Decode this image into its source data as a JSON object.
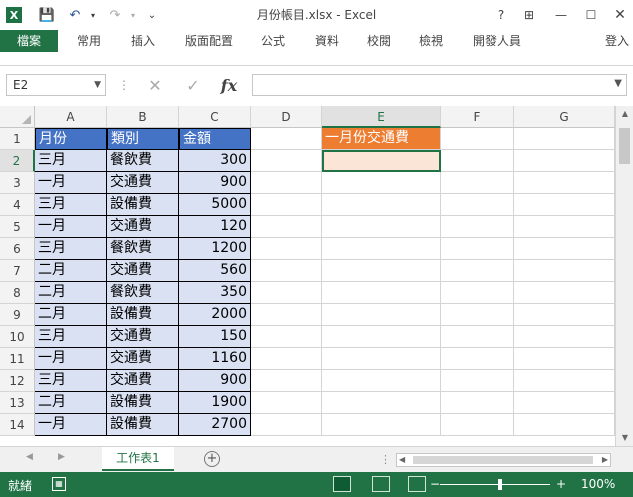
{
  "app": {
    "title": "月份帳目.xlsx - Excel",
    "logo": "X",
    "qat": {
      "save_icon": "💾",
      "undo_icon": "↶",
      "redo_icon": "↷",
      "customize_icon": "⌄"
    },
    "window_buttons": {
      "help": "?",
      "restore_ribbon": "⊞",
      "minimize": "—",
      "maximize": "☐"
    }
  },
  "ribbon": {
    "tabs": [
      "檔案",
      "常用",
      "插入",
      "版面配置",
      "公式",
      "資料",
      "校閱",
      "檢視",
      "開發人員"
    ],
    "signin": "登入"
  },
  "formula_bar": {
    "name_box": "E2",
    "cancel_icon": "✕",
    "enter_icon": "✓",
    "fx_label": "fx",
    "formula": ""
  },
  "sheet": {
    "columns": [
      "A",
      "B",
      "C",
      "D",
      "E",
      "F",
      "G"
    ],
    "active_column": "E",
    "active_row": 2,
    "rows": [
      1,
      2,
      3,
      4,
      5,
      6,
      7,
      8,
      9,
      10,
      11,
      12,
      13,
      14
    ],
    "table_header": [
      "月份",
      "類別",
      "金額"
    ],
    "table_rows": [
      [
        "三月",
        "餐飲費",
        "300"
      ],
      [
        "一月",
        "交通費",
        "900"
      ],
      [
        "三月",
        "設備費",
        "5000"
      ],
      [
        "一月",
        "交通費",
        "120"
      ],
      [
        "三月",
        "餐飲費",
        "1200"
      ],
      [
        "二月",
        "交通費",
        "560"
      ],
      [
        "二月",
        "餐飲費",
        "350"
      ],
      [
        "二月",
        "設備費",
        "2000"
      ],
      [
        "三月",
        "交通費",
        "150"
      ],
      [
        "一月",
        "交通費",
        "1160"
      ],
      [
        "三月",
        "交通費",
        "900"
      ],
      [
        "二月",
        "設備費",
        "1900"
      ],
      [
        "一月",
        "設備費",
        "2700"
      ]
    ],
    "e1": "一月份交通費",
    "e2": ""
  },
  "sheet_tabs": {
    "active": "工作表1",
    "add_icon": "+"
  },
  "status": {
    "ready": "就緒",
    "zoom": "100%",
    "minus": "−",
    "plus": "+"
  },
  "colors": {
    "accent": "#217346",
    "header_fill": "#4472c4",
    "band_fill": "#d9e1f2",
    "e1_fill": "#ed7d31",
    "e2_fill": "#fbe5d6"
  }
}
